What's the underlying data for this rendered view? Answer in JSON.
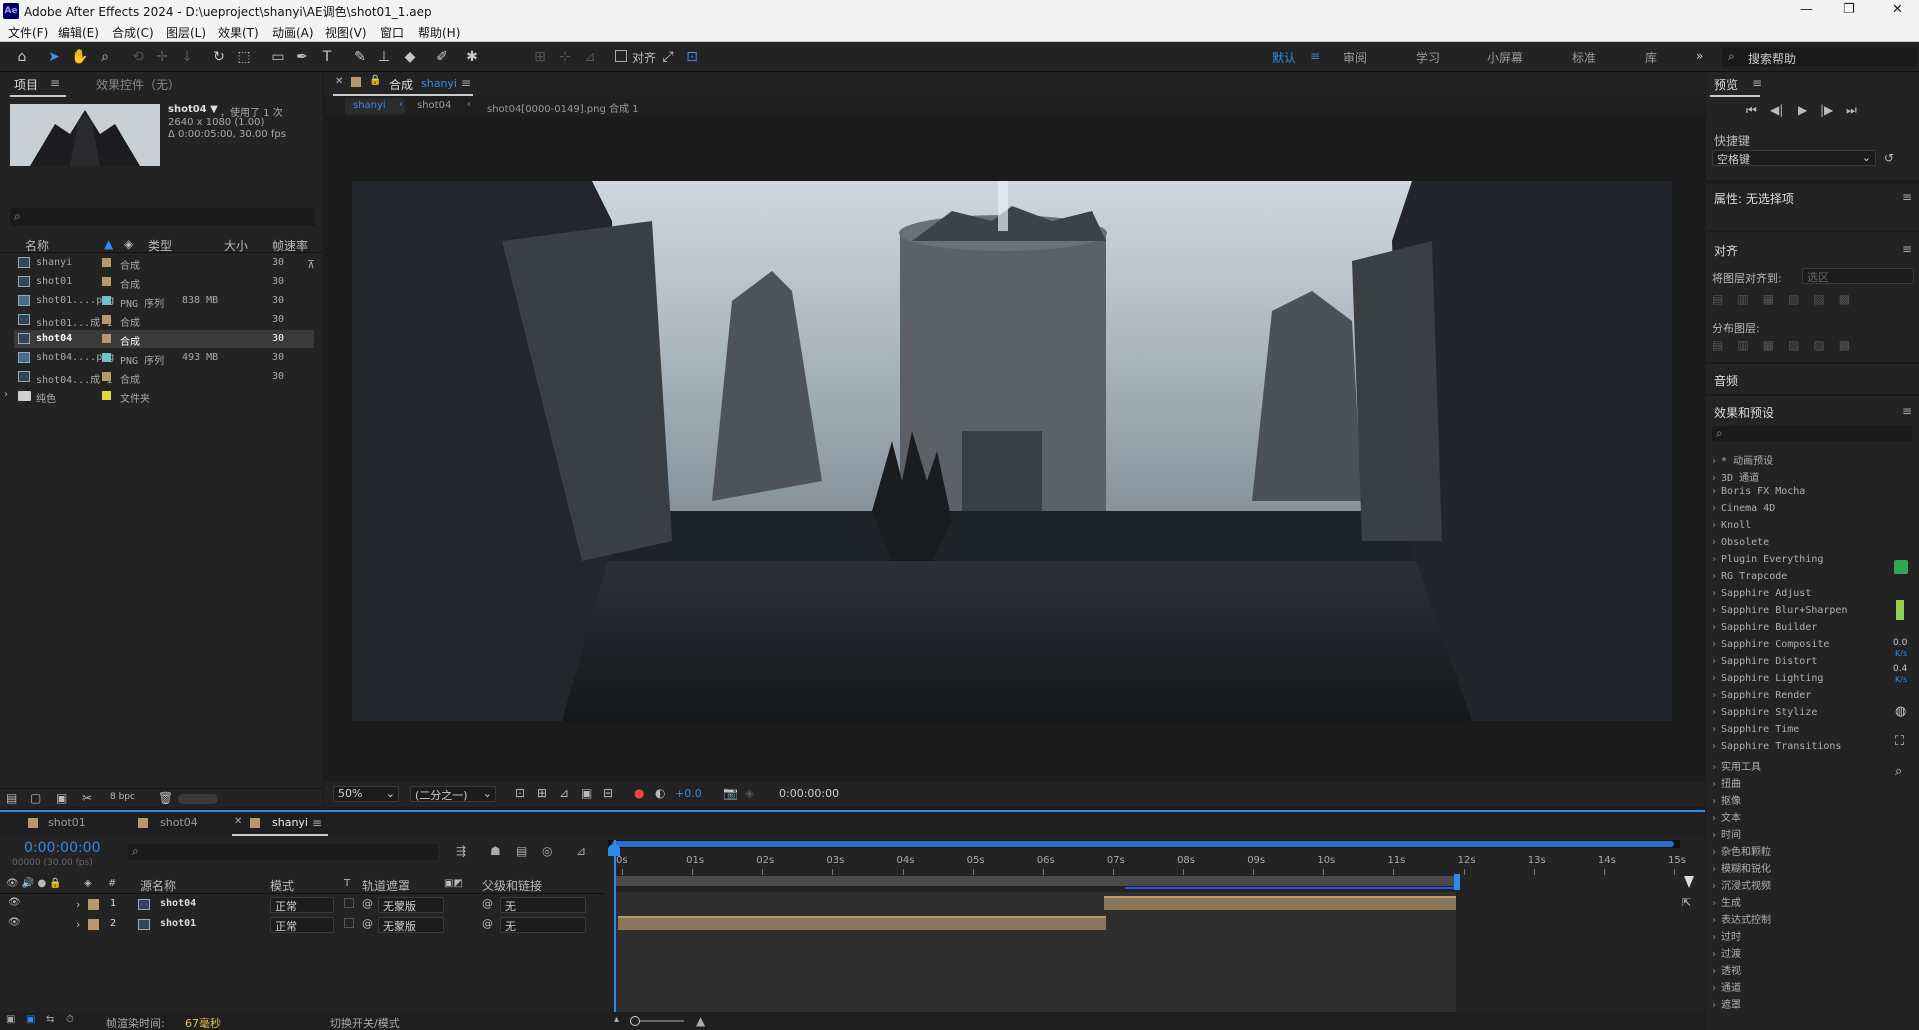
{
  "app": {
    "title": "Adobe After Effects 2024 - D:\\ueproject\\shanyi\\AE调色\\shot01_1.aep",
    "logo": "Ae"
  },
  "menu": [
    "文件(F)",
    "编辑(E)",
    "合成(C)",
    "图层(L)",
    "效果(T)",
    "动画(A)",
    "视图(V)",
    "窗口",
    "帮助(H)"
  ],
  "toolbar": {
    "align_label": "对齐",
    "workspaces": [
      "默认",
      "审阅",
      "学习",
      "小屏幕",
      "标准",
      "库"
    ],
    "active_workspace": "默认",
    "search_help_placeholder": "搜索帮助"
  },
  "project": {
    "tab_project": "项目",
    "tab_effects": "效果控件（无）",
    "thumb_name": "shot04 ▼",
    "thumb_used": "，使用了 1 次",
    "thumb_size": "2640 x 1080 (1.00)",
    "thumb_dur": "Δ 0:00:05:00, 30.00 fps",
    "columns": {
      "name": "名称",
      "type": "类型",
      "size": "大小",
      "fps": "帧速率"
    },
    "items": [
      {
        "name": "shanyi",
        "type": "合成",
        "size": "",
        "fps": "30",
        "icon": "comp",
        "color": "#b89a6a",
        "selected": false
      },
      {
        "name": "shot01",
        "type": "合成",
        "size": "",
        "fps": "30",
        "icon": "comp",
        "color": "#b89a6a",
        "selected": false
      },
      {
        "name": "shot01....png",
        "type": "PNG 序列",
        "size": "838 MB",
        "fps": "30",
        "icon": "png",
        "color": "#6ec3c9",
        "selected": false
      },
      {
        "name": "shot01...成 1",
        "type": "合成",
        "size": "",
        "fps": "30",
        "icon": "comp",
        "color": "#b89a6a",
        "selected": false
      },
      {
        "name": "shot04",
        "type": "合成",
        "size": "",
        "fps": "30",
        "icon": "comp",
        "color": "#b89a6a",
        "selected": true
      },
      {
        "name": "shot04....png",
        "type": "PNG 序列",
        "size": "493 MB",
        "fps": "30",
        "icon": "png",
        "color": "#6ec3c9",
        "selected": false
      },
      {
        "name": "shot04...成 1",
        "type": "合成",
        "size": "",
        "fps": "30",
        "icon": "comp",
        "color": "#b89a6a",
        "selected": false
      },
      {
        "name": "纯色",
        "type": "文件夹",
        "size": "",
        "fps": "",
        "icon": "folder",
        "color": "#e6d83a",
        "selected": false
      }
    ],
    "bpc": "8 bpc"
  },
  "composition": {
    "tab_label": "合成",
    "tab_name": "shanyi",
    "breadcrumbs": [
      "shanyi",
      "shot04",
      "shot04[0000-0149].png 合成 1"
    ],
    "zoom": "50%",
    "resolution": "(二分之一)",
    "exposure": "+0.0",
    "timecode": "0:00:00:00"
  },
  "right": {
    "preview_title": "预览",
    "shortcut_label": "快捷键",
    "shortcut_value": "空格键",
    "properties_title": "属性: 无选择项",
    "align_title": "对齐",
    "align_to_label": "将图层对齐到:",
    "align_to_value": "选区",
    "distribute_label": "分布图层:",
    "audio_title": "音频",
    "effects_title": "效果和预设",
    "effects": [
      "* 动画预设",
      "3D 通道",
      "Boris FX Mocha",
      "Cinema 4D",
      "Knoll",
      "Obsolete",
      "Plugin Everything",
      "RG Trapcode",
      "Sapphire Adjust",
      "Sapphire Blur+Sharpen",
      "Sapphire Builder",
      "Sapphire Composite",
      "Sapphire Distort",
      "Sapphire Lighting",
      "Sapphire Render",
      "Sapphire Stylize",
      "Sapphire Time",
      "Sapphire Transitions",
      "实用工具",
      "扭曲",
      "抠像",
      "文本",
      "时间",
      "杂色和颗粒",
      "模糊和锐化",
      "沉浸式视频",
      "生成",
      "表达式控制",
      "过时",
      "过渡",
      "透视",
      "通道",
      "遮罩"
    ],
    "meter_1": "0.0",
    "meter_1_unit": "K/s",
    "meter_2": "0.4",
    "meter_2_unit": "K/s"
  },
  "timeline": {
    "tabs": [
      "shot01",
      "shot04",
      "shanyi"
    ],
    "active_tab": "shanyi",
    "timecode": "0:00:00:00",
    "frame_info": "00000 (30.00 fps)",
    "columns": {
      "num": "#",
      "source": "源名称",
      "mode": "模式",
      "t": "T",
      "trkmat": "轨道遮罩",
      "parent": "父级和链接"
    },
    "layers": [
      {
        "num": "1",
        "name": "shot04",
        "mode": "正常",
        "trkmat": "无蒙版",
        "parent": "无"
      },
      {
        "num": "2",
        "name": "shot01",
        "mode": "正常",
        "trkmat": "无蒙版",
        "parent": "无"
      }
    ],
    "ruler": [
      "0s",
      "01s",
      "02s",
      "03s",
      "04s",
      "05s",
      "06s",
      "07s",
      "08s",
      "09s",
      "10s",
      "11s",
      "12s",
      "13s",
      "14s",
      "15s"
    ],
    "render_time_label": "帧渲染时间:",
    "render_time_value": "67毫秒",
    "toggle_label": "切换开关/模式"
  }
}
